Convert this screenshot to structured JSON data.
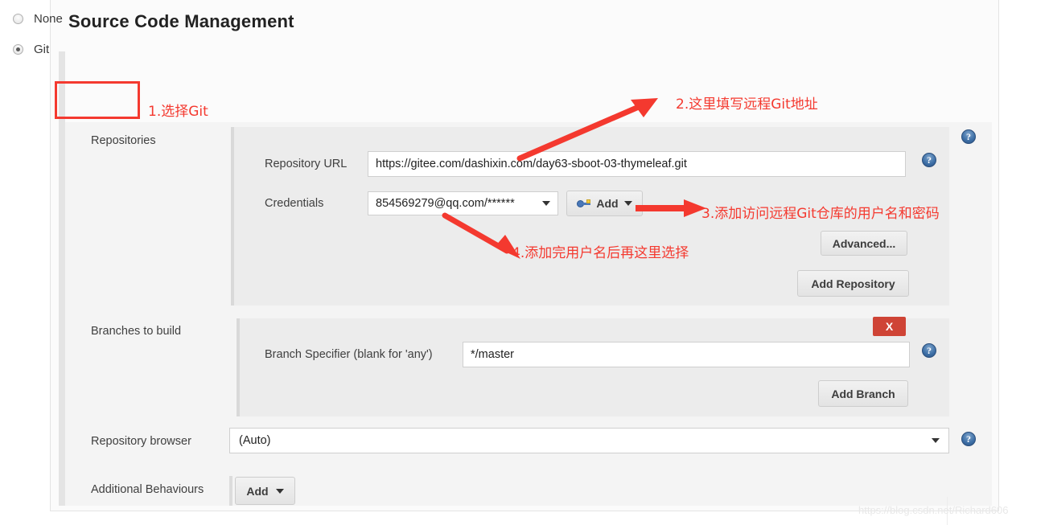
{
  "page": {
    "title": "Source Code Management",
    "watermark": "https://blog.csdn.net/Richard606"
  },
  "scm_options": [
    {
      "label": "None",
      "checked": false
    },
    {
      "label": "Git",
      "checked": true
    }
  ],
  "repositories": {
    "label": "Repositories",
    "repository_url": {
      "label": "Repository URL",
      "value": "https://gitee.com/dashixin.com/day63-sboot-03-thymeleaf.git"
    },
    "credentials": {
      "label": "Credentials",
      "selected": "854569279@qq.com/******",
      "add_button": "Add"
    },
    "advanced_button": "Advanced...",
    "add_repository_button": "Add Repository"
  },
  "branches": {
    "label": "Branches to build",
    "specifier": {
      "label": "Branch Specifier (blank for 'any')",
      "value": "*/master"
    },
    "delete_button": "X",
    "add_branch_button": "Add Branch"
  },
  "repository_browser": {
    "label": "Repository browser",
    "selected": "(Auto)"
  },
  "additional_behaviours": {
    "label": "Additional Behaviours",
    "add_button": "Add"
  },
  "help": {
    "glyph": "?"
  },
  "annotations": [
    {
      "id": 1,
      "text": "1.选择Git"
    },
    {
      "id": 2,
      "text": "2.这里填写远程Git地址"
    },
    {
      "id": 3,
      "text": "3.添加访问远程Git仓库的用户名和密码"
    },
    {
      "id": 4,
      "text": "4.添加完用户名后再这里选择"
    }
  ],
  "colors": {
    "annotation_red": "#f4392f",
    "delete_button_red": "#cf4436",
    "help_icon_blue": "#3c6ea5"
  }
}
